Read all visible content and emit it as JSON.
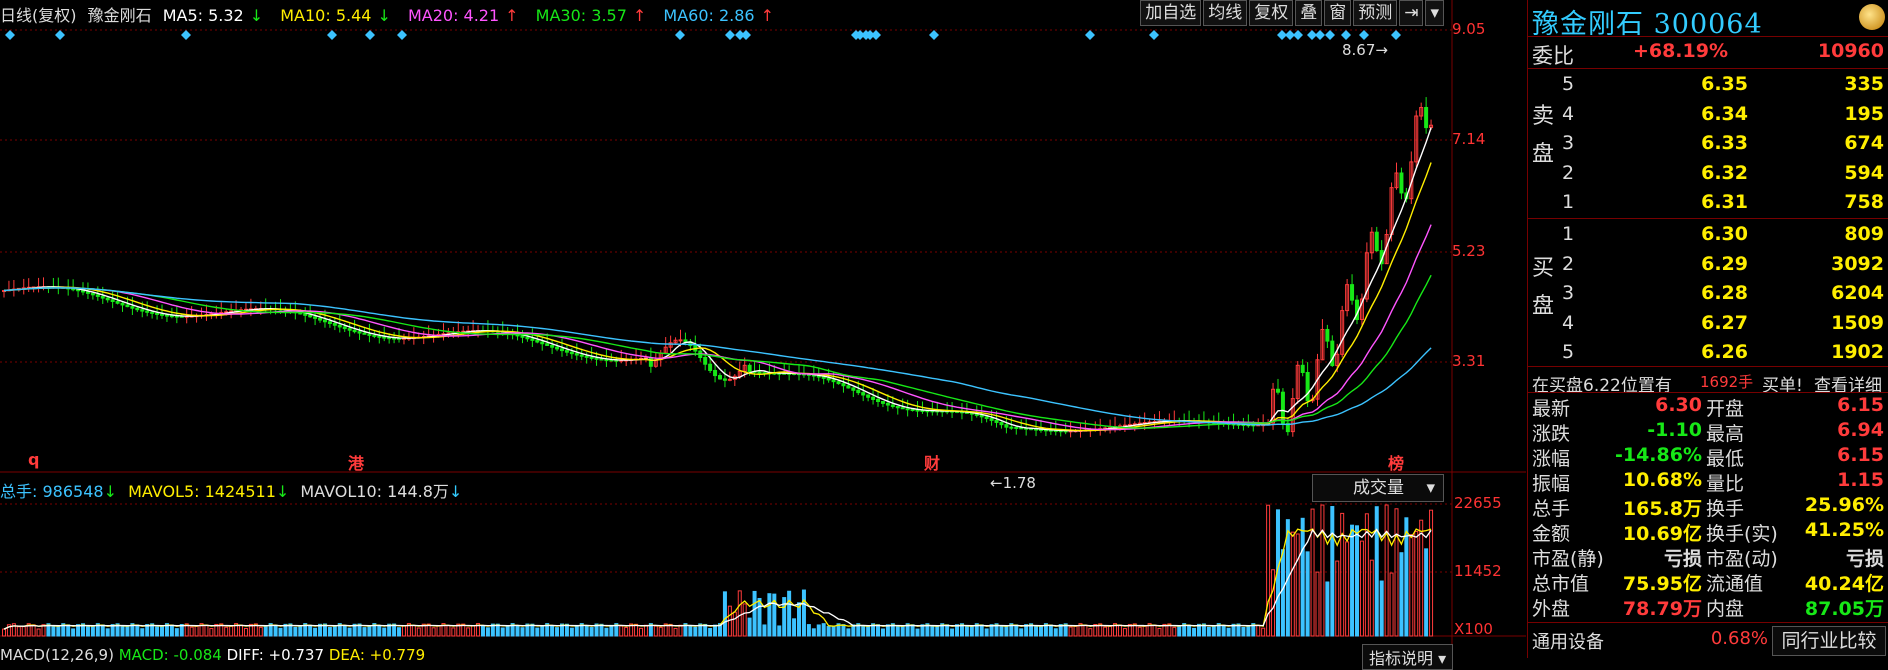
{
  "top": {
    "title": "日线(复权)",
    "name": "豫金刚石",
    "ma5_label": "MA5: 5.32",
    "ma10_label": "MA10: 5.44",
    "ma20_label": "MA20: 4.21",
    "ma30_label": "MA30: 3.57",
    "ma60_label": "MA60: 2.86",
    "ma5_arrow": "↓",
    "ma10_arrow": "↓",
    "ma20_arrow": "↑",
    "ma30_arrow": "↑",
    "ma60_arrow": "↑"
  },
  "toolbar": [
    "加自选",
    "均线",
    "复权",
    "叠",
    "窗",
    "预测"
  ],
  "price_axis": [
    "9.05",
    "7.14",
    "5.23",
    "3.31"
  ],
  "annotations": {
    "high": "8.67",
    "low": "1.78"
  },
  "event_markers": [
    "q",
    "港",
    "财",
    "榜"
  ],
  "volume": {
    "line": "总手: 986548",
    "line_arrow": "↓",
    "mavol5": "MAVOL5: 1424511",
    "mavol5_arrow": "↓",
    "mavol10": "MAVOL10: 144.8万",
    "mavol10_arrow": "↓",
    "select": "成交量",
    "axis": [
      "22655",
      "11452",
      "X100"
    ]
  },
  "macd": {
    "line": "MACD(12,26,9)",
    "macd": "MACD: -0.084",
    "diff": "DIFF: +0.737",
    "dea": "DEA: +0.779",
    "help": "指标说明"
  },
  "stock": {
    "title": "豫金刚石 300064",
    "weibi_label": "委比",
    "weibi": "+68.19%",
    "weicha": "10960",
    "sell_label": "卖盘",
    "buy_label": "买盘",
    "sells": [
      {
        "level": "5",
        "price": "6.35",
        "vol": "335"
      },
      {
        "level": "4",
        "price": "6.34",
        "vol": "195"
      },
      {
        "level": "3",
        "price": "6.33",
        "vol": "674"
      },
      {
        "level": "2",
        "price": "6.32",
        "vol": "594"
      },
      {
        "level": "1",
        "price": "6.31",
        "vol": "758"
      }
    ],
    "buys": [
      {
        "level": "1",
        "price": "6.30",
        "vol": "809"
      },
      {
        "level": "2",
        "price": "6.29",
        "vol": "3092"
      },
      {
        "level": "3",
        "price": "6.28",
        "vol": "6204"
      },
      {
        "level": "4",
        "price": "6.27",
        "vol": "1509"
      },
      {
        "level": "5",
        "price": "6.26",
        "vol": "1902"
      }
    ],
    "notice_prefix": "在买盘6.22位置有",
    "notice_vol": "1692手",
    "notice_suffix": "买单!",
    "notice_link": "查看详细",
    "stats": [
      {
        "l1": "最新",
        "v1": "6.30",
        "c1": "red",
        "l2": "开盘",
        "v2": "6.15",
        "c2": "red"
      },
      {
        "l1": "涨跌",
        "v1": "-1.10",
        "c1": "green",
        "l2": "最高",
        "v2": "6.94",
        "c2": "red"
      },
      {
        "l1": "涨幅",
        "v1": "-14.86%",
        "c1": "green",
        "l2": "最低",
        "v2": "6.15",
        "c2": "red"
      },
      {
        "l1": "振幅",
        "v1": "10.68%",
        "c1": "yellow",
        "l2": "量比",
        "v2": "1.15",
        "c2": "red"
      },
      {
        "l1": "总手",
        "v1": "165.8万",
        "c1": "yellow",
        "l2": "换手",
        "v2": "25.96%",
        "c2": "yellow"
      },
      {
        "l1": "金额",
        "v1": "10.69亿",
        "c1": "yellow",
        "l2": "换手(实)",
        "v2": "41.25%",
        "c2": "yellow"
      },
      {
        "l1": "市盈(静)",
        "v1": "亏损",
        "c1": "lbl",
        "l2": "市盈(动)",
        "v2": "亏损",
        "c2": "lbl"
      },
      {
        "l1": "总市值",
        "v1": "75.95亿",
        "c1": "yellow",
        "l2": "流通值",
        "v2": "40.24亿",
        "c2": "yellow"
      },
      {
        "l1": "外盘",
        "v1": "78.79万",
        "c1": "red",
        "l2": "内盘",
        "v2": "87.05万",
        "c2": "green"
      }
    ],
    "industry": "通用设备",
    "industry_pct": "0.68%",
    "compare_button": "同行业比较"
  },
  "colors": {
    "up": "#ff3b3b",
    "down": "#17e817",
    "ma5": "#ffffff",
    "ma10": "#ffee00",
    "ma20": "#ff55ff",
    "ma30": "#17e817",
    "ma60": "#3cc3ff",
    "grid": "#7a0000"
  }
}
